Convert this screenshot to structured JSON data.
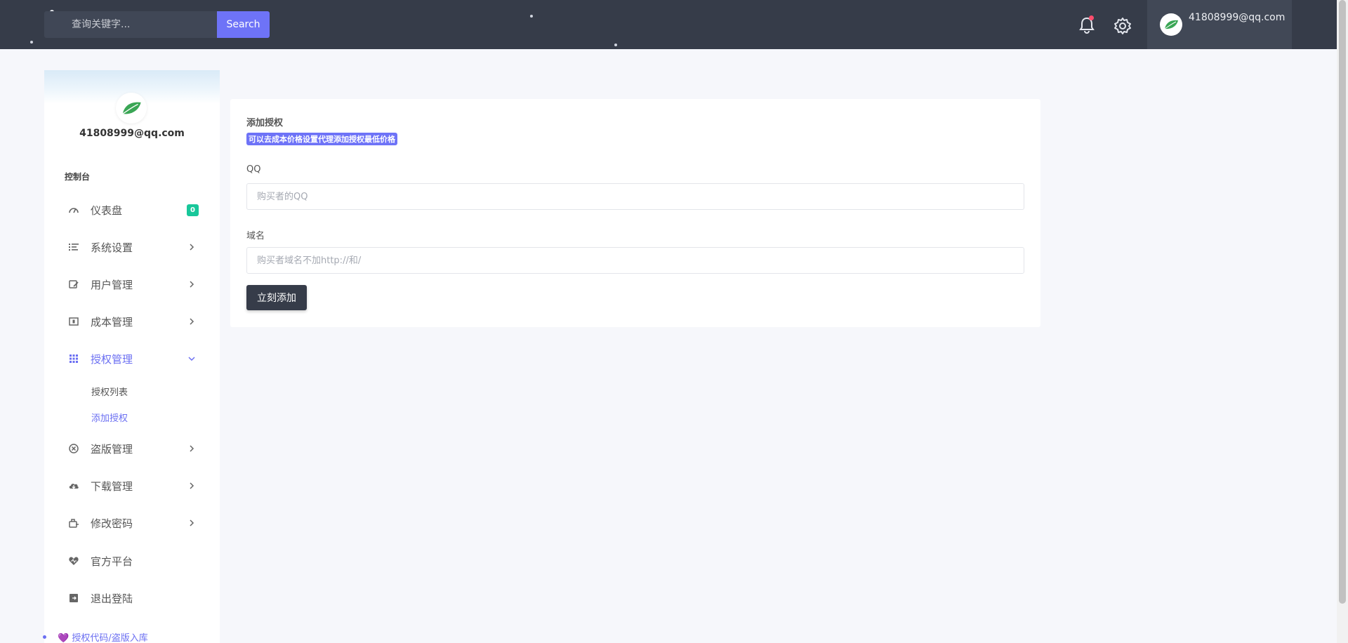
{
  "header": {
    "search_placeholder": "查询关键字...",
    "search_button": "Search",
    "user_email": "41808999@qq.com"
  },
  "sidebar": {
    "user_email": "41808999@qq.com",
    "section_title": "控制台",
    "items": [
      {
        "label": "仪表盘",
        "icon": "gauge-icon",
        "badge": "0"
      },
      {
        "label": "系统设置",
        "icon": "list-icon"
      },
      {
        "label": "用户管理",
        "icon": "user-edit-icon"
      },
      {
        "label": "成本管理",
        "icon": "money-icon"
      },
      {
        "label": "授权管理",
        "icon": "grid-icon",
        "expanded": true
      },
      {
        "label": "盗版管理",
        "icon": "ban-icon"
      },
      {
        "label": "下载管理",
        "icon": "cloud-download-icon"
      },
      {
        "label": "修改密码",
        "icon": "key-icon"
      },
      {
        "label": "官方平台",
        "icon": "heart-icon"
      },
      {
        "label": "退出登陆",
        "icon": "logout-icon"
      }
    ],
    "sub_items": [
      {
        "label": "授权列表"
      },
      {
        "label": "添加授权",
        "active": true
      }
    ],
    "footer_link": "💜 授权代码/盗版入库"
  },
  "form": {
    "title": "添加授权",
    "tag": "可以去成本价格设置代理添加授权最低价格",
    "qq_label": "QQ",
    "qq_placeholder": "购买者的QQ",
    "domain_label": "域名",
    "domain_placeholder": "购买者域名不加http://和/",
    "submit": "立刻添加"
  },
  "colors": {
    "topbar": "#363c49",
    "accent": "#6e73f7",
    "badge": "#18c79a"
  }
}
